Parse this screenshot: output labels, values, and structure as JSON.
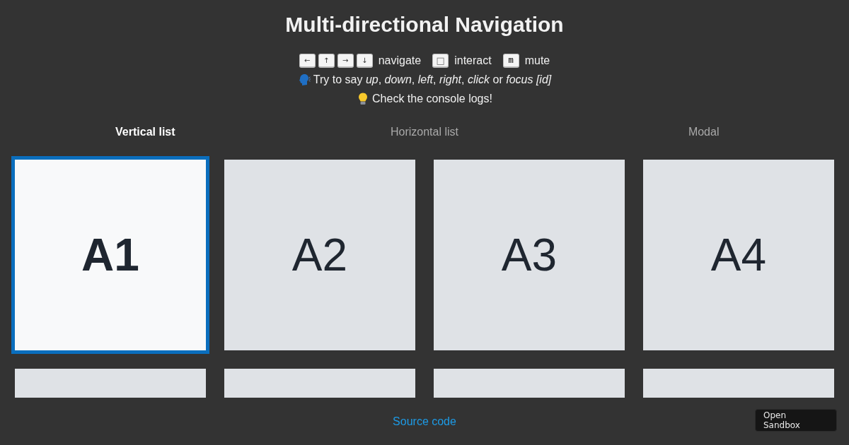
{
  "title": "Multi-directional Navigation",
  "legend": [
    {
      "keys": [
        "←",
        "↑",
        "→",
        "↓"
      ],
      "label": "navigate"
    },
    {
      "keys": [
        "□"
      ],
      "label": "interact"
    },
    {
      "keys": [
        "m"
      ],
      "label": "mute"
    }
  ],
  "hints": [
    {
      "kind": "voice",
      "text": "Try to say *up*, *down*, *left*, *right*, *click* or *focus [id]*"
    },
    {
      "kind": "console",
      "text": "Check the console logs!"
    }
  ],
  "tabs": [
    {
      "label": "Vertical list",
      "selected": true
    },
    {
      "label": "Horizontal list",
      "selected": false
    },
    {
      "label": "Modal",
      "selected": false
    }
  ],
  "tile_rows": [
    [
      {
        "label": "A1",
        "focused": true
      },
      {
        "label": "A2",
        "focused": false
      },
      {
        "label": "A3",
        "focused": false
      },
      {
        "label": "A4",
        "focused": false
      }
    ],
    [
      {
        "focused": false
      },
      {
        "focused": false
      },
      {
        "focused": false
      },
      {
        "focused": false
      }
    ]
  ],
  "footer": {
    "link": "Source code",
    "button": "Open Sandbox"
  }
}
